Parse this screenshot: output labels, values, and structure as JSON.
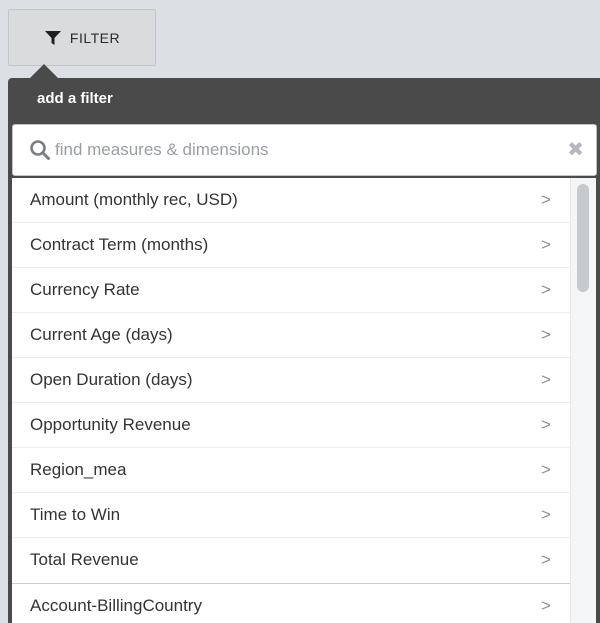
{
  "toolbar": {
    "filter_label": "FILTER",
    "filter_icon": "funnel-icon"
  },
  "panel": {
    "title": "add a filter"
  },
  "search": {
    "placeholder": "find measures & dimensions",
    "value": "",
    "search_icon": "magnifier-icon",
    "clear_icon": "close-icon",
    "clear_glyph": "✖"
  },
  "list": {
    "chevron": ">",
    "items": [
      {
        "label": "Amount (monthly rec, USD)"
      },
      {
        "label": "Contract Term (months)"
      },
      {
        "label": "Currency Rate"
      },
      {
        "label": "Current Age (days)"
      },
      {
        "label": "Open Duration (days)"
      },
      {
        "label": "Opportunity Revenue"
      },
      {
        "label": "Region_mea"
      },
      {
        "label": "Time to Win"
      },
      {
        "label": "Total Revenue"
      },
      {
        "label": "Account-BillingCountry"
      }
    ]
  }
}
